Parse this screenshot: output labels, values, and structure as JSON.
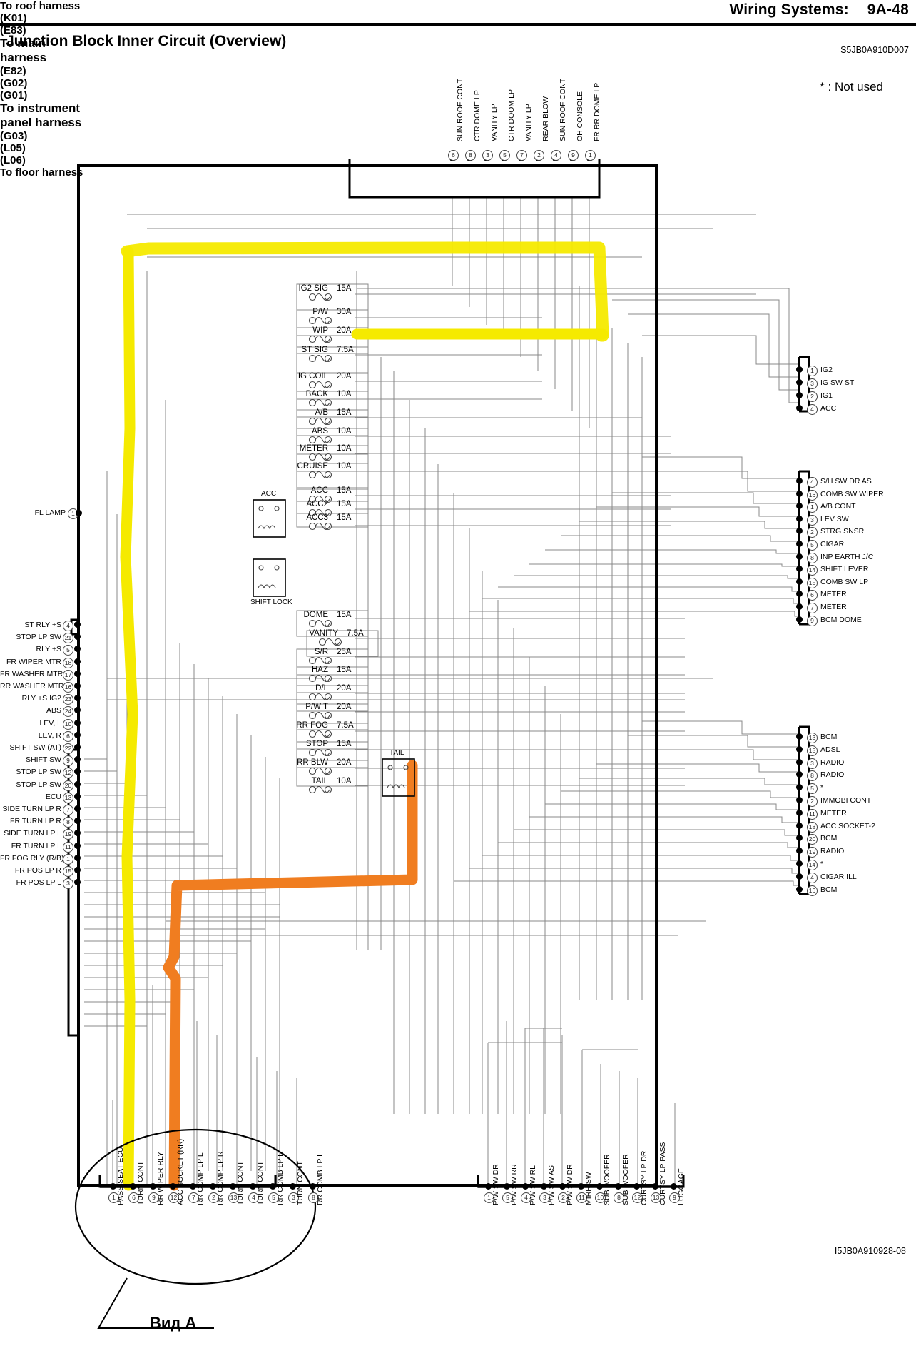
{
  "header": {
    "section": "Wiring Systems:",
    "page": "9A-48",
    "title": "Junction Block Inner Circuit (Overview)",
    "doc_code": "S5JB0A910D007",
    "figure_code": "I5JB0A910928-08",
    "note": "* : Not used"
  },
  "callouts": {
    "to_roof_harness": "To roof harness",
    "to_main_harness": "To main\nharness",
    "to_instrument_panel_harness": "To instrument\npanel harness",
    "to_floor_harness": "To floor harness",
    "view_a": "Вид A"
  },
  "connector_ids": {
    "k01": "(K01)",
    "g02": "(G02)",
    "g01": "(G01)",
    "g03": "(G03)",
    "e83": "(E83)",
    "e82": "(E82)",
    "l05": "(L05)",
    "l06": "(L06)"
  },
  "fuses": [
    {
      "name": "IG2 SIG",
      "amp": "15A"
    },
    {
      "name": "P/W",
      "amp": "30A"
    },
    {
      "name": "WIP",
      "amp": "20A"
    },
    {
      "name": "ST SIG",
      "amp": "7.5A"
    },
    {
      "name": "IG COIL",
      "amp": "20A"
    },
    {
      "name": "BACK",
      "amp": "10A"
    },
    {
      "name": "A/B",
      "amp": "15A"
    },
    {
      "name": "ABS",
      "amp": "10A"
    },
    {
      "name": "METER",
      "amp": "10A"
    },
    {
      "name": "CRUISE",
      "amp": "10A"
    },
    {
      "name": "ACC",
      "amp": "15A"
    },
    {
      "name": "ACC2",
      "amp": "15A"
    },
    {
      "name": "ACC3",
      "amp": "15A"
    },
    {
      "name": "DOME",
      "amp": "15A"
    },
    {
      "name": "VANITY",
      "amp": "7.5A"
    },
    {
      "name": "S/R",
      "amp": "25A"
    },
    {
      "name": "HAZ",
      "amp": "15A"
    },
    {
      "name": "D/L",
      "amp": "20A"
    },
    {
      "name": "P/W T",
      "amp": "20A"
    },
    {
      "name": "RR FOG",
      "amp": "7.5A"
    },
    {
      "name": "STOP",
      "amp": "15A"
    },
    {
      "name": "RR BLW",
      "amp": "20A"
    },
    {
      "name": "TAIL",
      "amp": "10A"
    }
  ],
  "relays": [
    {
      "name": "ACC"
    },
    {
      "name": "SHIFT LOCK"
    },
    {
      "name": "TAIL"
    }
  ],
  "k01": {
    "title": "To roof harness",
    "id": "(K01)",
    "pins": [
      {
        "no": "6",
        "label": "SUN ROOF CONT"
      },
      {
        "no": "8",
        "label": "CTR DOME LP"
      },
      {
        "no": "3",
        "label": "VANITY LP"
      },
      {
        "no": "5",
        "label": "CTR DOOM LP"
      },
      {
        "no": "7",
        "label": "VANITY LP"
      },
      {
        "no": "2",
        "label": "REAR BLOW"
      },
      {
        "no": "4",
        "label": "SUN ROOF CONT"
      },
      {
        "no": "9",
        "label": "OH CONSOLE"
      },
      {
        "no": "1",
        "label": "FR RR DOME LP"
      }
    ]
  },
  "e83": {
    "id": "(E83)",
    "pins": [
      {
        "no": "1",
        "label": "FL LAMP"
      }
    ]
  },
  "e82": {
    "id": "(E82)",
    "title": "To main\nharness",
    "pins": [
      {
        "no": "4",
        "label": "ST RLY +S"
      },
      {
        "no": "21",
        "label": "STOP LP SW"
      },
      {
        "no": "5",
        "label": "RLY +S"
      },
      {
        "no": "18",
        "label": "FR WIPER MTR"
      },
      {
        "no": "17",
        "label": "FR WASHER MTR"
      },
      {
        "no": "16",
        "label": "RR WASHER MTR"
      },
      {
        "no": "23",
        "label": "RLY +S IG2"
      },
      {
        "no": "24",
        "label": "ABS"
      },
      {
        "no": "10",
        "label": "LEV, L"
      },
      {
        "no": "6",
        "label": "LEV, R"
      },
      {
        "no": "22",
        "label": "SHIFT SW (AT)"
      },
      {
        "no": "9",
        "label": "SHIFT SW"
      },
      {
        "no": "12",
        "label": "STOP LP SW"
      },
      {
        "no": "20",
        "label": "STOP LP SW"
      },
      {
        "no": "13",
        "label": "ECU"
      },
      {
        "no": "7",
        "label": "SIDE TURN LP R"
      },
      {
        "no": "8",
        "label": "FR TURN LP R"
      },
      {
        "no": "19",
        "label": "SIDE TURN LP L"
      },
      {
        "no": "11",
        "label": "FR TURN LP L"
      },
      {
        "no": "1",
        "label": "FR FOG RLY (R/B)"
      },
      {
        "no": "15",
        "label": "FR POS LP R"
      },
      {
        "no": "3",
        "label": "FR POS LP L"
      }
    ]
  },
  "g02": {
    "id": "(G02)",
    "pins": [
      {
        "no": "1",
        "label": "IG2"
      },
      {
        "no": "3",
        "label": "IG SW ST"
      },
      {
        "no": "2",
        "label": "IG1"
      },
      {
        "no": "4",
        "label": "ACC"
      }
    ]
  },
  "g01": {
    "id": "(G01)",
    "title": "To instrument\npanel harness",
    "pins": [
      {
        "no": "4",
        "label": "S/H SW DR AS"
      },
      {
        "no": "16",
        "label": "COMB SW WIPER"
      },
      {
        "no": "1",
        "label": "A/B CONT"
      },
      {
        "no": "3",
        "label": "LEV SW"
      },
      {
        "no": "2",
        "label": "STRG SNSR"
      },
      {
        "no": "5",
        "label": "CIGAR"
      },
      {
        "no": "8",
        "label": "INP EARTH J/C"
      },
      {
        "no": "14",
        "label": "SHIFT LEVER"
      },
      {
        "no": "15",
        "label": "COMB SW LP"
      },
      {
        "no": "6",
        "label": "METER"
      },
      {
        "no": "7",
        "label": "METER"
      },
      {
        "no": "9",
        "label": "BCM DOME"
      }
    ]
  },
  "g03": {
    "id": "(G03)",
    "pins": [
      {
        "no": "13",
        "label": "BCM"
      },
      {
        "no": "15",
        "label": "ADSL"
      },
      {
        "no": "3",
        "label": "RADIO"
      },
      {
        "no": "8",
        "label": "RADIO"
      },
      {
        "no": "5",
        "label": "*"
      },
      {
        "no": "2",
        "label": "IMMOBI CONT"
      },
      {
        "no": "11",
        "label": "METER"
      },
      {
        "no": "18",
        "label": "ACC SOCKET-2"
      },
      {
        "no": "20",
        "label": "BCM"
      },
      {
        "no": "19",
        "label": "RADIO"
      },
      {
        "no": "14",
        "label": "*"
      },
      {
        "no": "4",
        "label": "CIGAR ILL"
      },
      {
        "no": "16",
        "label": "BCM"
      }
    ]
  },
  "l05": {
    "id": "(L05)",
    "pins": [
      {
        "no": "1",
        "label": "PASS SEAT ECU"
      },
      {
        "no": "6",
        "label": "TURN CONT"
      },
      {
        "no": "9",
        "label": "RR WIPER RLY"
      },
      {
        "no": "12",
        "label": "ACC SOCKET (RR)"
      },
      {
        "no": "7",
        "label": "RR COMP LP L"
      },
      {
        "no": "2",
        "label": "RR COMP LP R"
      },
      {
        "no": "13",
        "label": "TURN CONT"
      },
      {
        "no": "4",
        "label": "TURN CONT"
      },
      {
        "no": "5",
        "label": "RR COMB LP R"
      },
      {
        "no": "3",
        "label": "TURN CONT"
      },
      {
        "no": "8",
        "label": "RR COMB LP L"
      }
    ]
  },
  "l06": {
    "id": "(L06)",
    "pins": [
      {
        "no": "1",
        "label": "P/W SW DR"
      },
      {
        "no": "5",
        "label": "P/W SW RR"
      },
      {
        "no": "4",
        "label": "P/W SW RL"
      },
      {
        "no": "3",
        "label": "P/W SW AS"
      },
      {
        "no": "2",
        "label": "P/W SW DR"
      },
      {
        "no": "11",
        "label": "MIRR SW"
      },
      {
        "no": "10",
        "label": "SUB WOOFER"
      },
      {
        "no": "8",
        "label": "SUB WOOFER"
      },
      {
        "no": "12",
        "label": "CURTSY LP DR"
      },
      {
        "no": "13",
        "label": "CURTSY LP PASS"
      },
      {
        "no": "9",
        "label": "LUGGAGE"
      }
    ]
  },
  "highlight_colors": {
    "yellow": "#f5ea00",
    "orange": "#f07d20"
  }
}
